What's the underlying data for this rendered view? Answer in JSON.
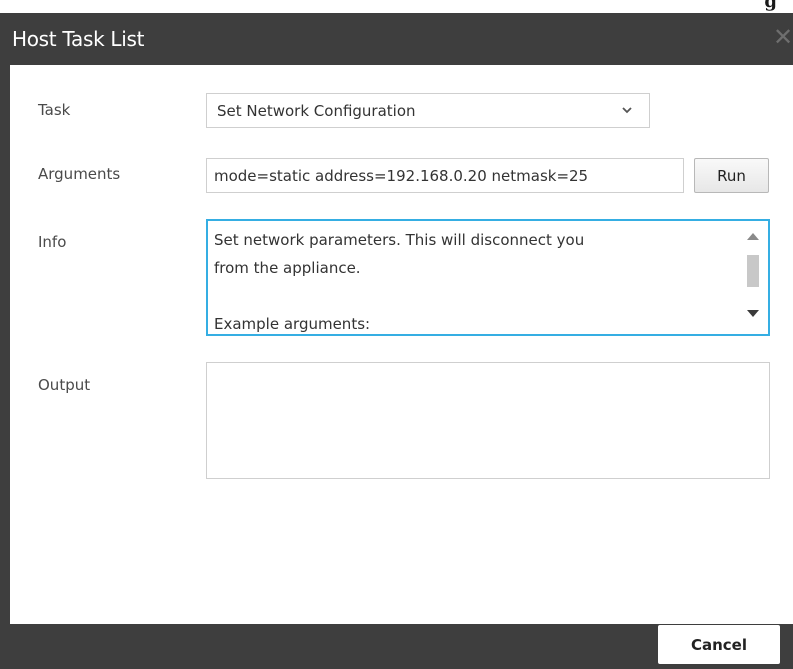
{
  "background_fragment": {
    "text": "g"
  },
  "dialog": {
    "title": "Host Task List",
    "close_icon": "close-icon"
  },
  "form": {
    "task": {
      "label": "Task",
      "selected_value": "Set Network Configuration",
      "icon": "chevron-down-icon"
    },
    "arguments": {
      "label": "Arguments",
      "value": "mode=static address=192.168.0.20 netmask=25"
    },
    "run_button": {
      "label": "Run"
    },
    "info": {
      "label": "Info",
      "lines": [
        "Set network parameters. This will disconnect you",
        "from the appliance.",
        "",
        "Example arguments:"
      ]
    },
    "output": {
      "label": "Output",
      "value": ""
    }
  },
  "footer": {
    "cancel_label": "Cancel"
  },
  "colors": {
    "dialog_chrome": "#3e3e3e",
    "focus_border": "#35aee3",
    "field_border": "#cfcfcf"
  }
}
